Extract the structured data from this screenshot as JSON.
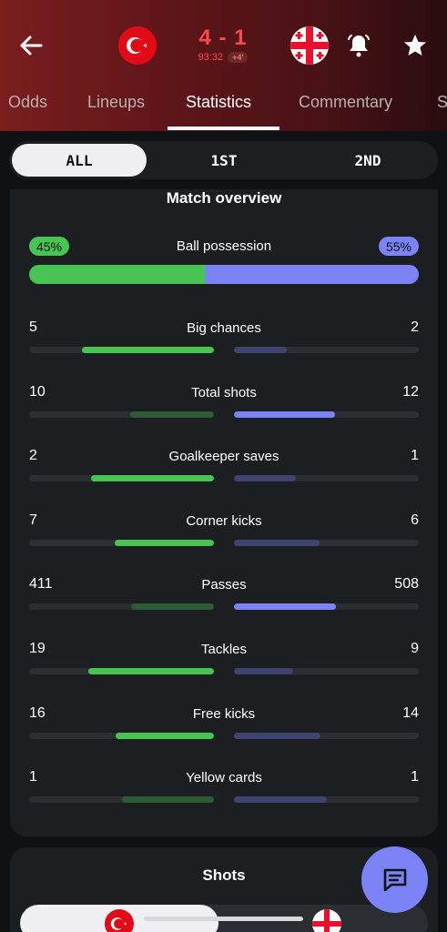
{
  "match": {
    "score": "4 - 1",
    "clock": "93:32",
    "added_time": "+4'"
  },
  "tabs": [
    {
      "label": "Odds"
    },
    {
      "label": "Lineups"
    },
    {
      "label": "Statistics"
    },
    {
      "label": "Commentary"
    },
    {
      "label": "S"
    }
  ],
  "periods": [
    {
      "label": "ALL"
    },
    {
      "label": "1ST"
    },
    {
      "label": "2ND"
    }
  ],
  "overview": {
    "title": "Match overview",
    "possession": {
      "label": "Ball possession",
      "home": "45%",
      "away": "55%",
      "home_value": 45,
      "away_value": 55
    },
    "stats": [
      {
        "label": "Big chances",
        "home": "5",
        "away": "2",
        "home_value": 5,
        "away_value": 2
      },
      {
        "label": "Total shots",
        "home": "10",
        "away": "12",
        "home_value": 10,
        "away_value": 12
      },
      {
        "label": "Goalkeeper saves",
        "home": "2",
        "away": "1",
        "home_value": 2,
        "away_value": 1
      },
      {
        "label": "Corner kicks",
        "home": "7",
        "away": "6",
        "home_value": 7,
        "away_value": 6
      },
      {
        "label": "Passes",
        "home": "411",
        "away": "508",
        "home_value": 411,
        "away_value": 508
      },
      {
        "label": "Tackles",
        "home": "19",
        "away": "9",
        "home_value": 19,
        "away_value": 9
      },
      {
        "label": "Free kicks",
        "home": "16",
        "away": "14",
        "home_value": 16,
        "away_value": 14
      },
      {
        "label": "Yellow cards",
        "home": "1",
        "away": "1",
        "home_value": 1,
        "away_value": 1
      }
    ]
  },
  "shots": {
    "title": "Shots"
  },
  "colors": {
    "home": "#47c452",
    "away": "#7b83f7",
    "score": "#ff4a4a"
  },
  "icons": [
    "back-arrow-icon",
    "bell-icon",
    "star-icon",
    "chat-icon",
    "turkey-flag-icon",
    "georgia-flag-icon"
  ]
}
